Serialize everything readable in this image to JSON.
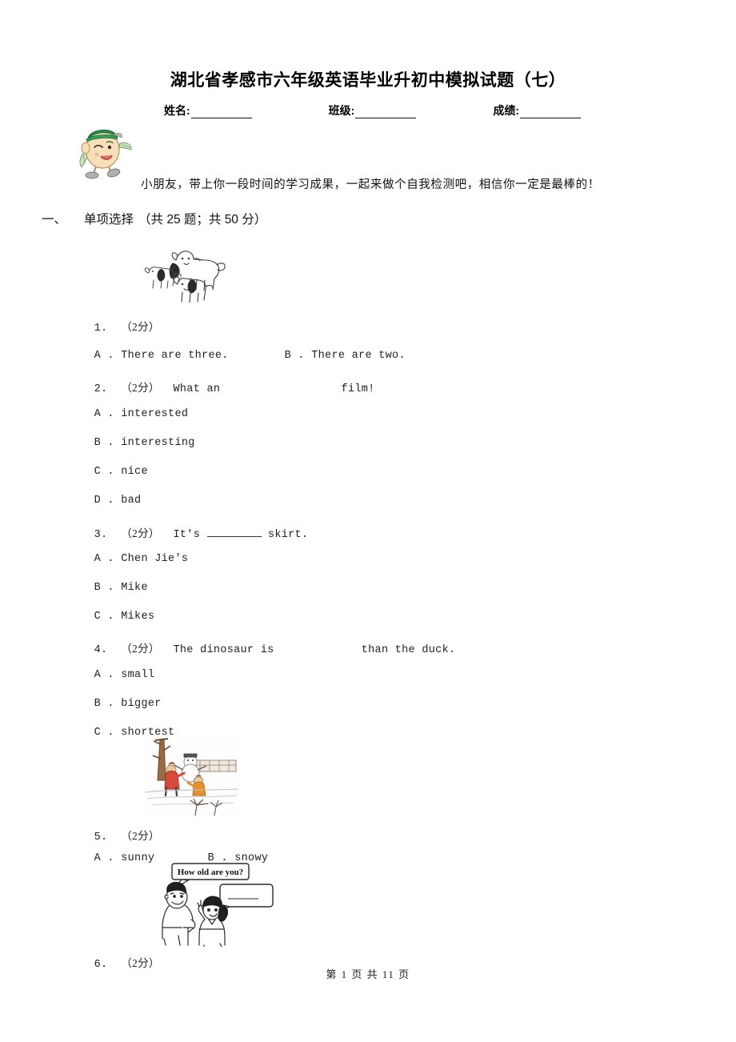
{
  "document": {
    "title": "湖北省孝感市六年级英语毕业升初中模拟试题（七）",
    "meta": {
      "name_label": "姓名:",
      "class_label": "班级:",
      "score_label": "成绩:"
    },
    "intro": "小朋友，带上你一段时间的学习成果，一起来做个自我检测吧，相信你一定是最棒的！",
    "footer": "第 1 页 共 11 页"
  },
  "section": {
    "index": "一、",
    "name": "单项选择",
    "meta": "（共 25 题；共 50 分）"
  },
  "questions": [
    {
      "number": "1.",
      "points": "（2分）",
      "stem": "",
      "figure": "three-dogs-illustration",
      "options": [
        {
          "letter": "A",
          "text": "There are three."
        },
        {
          "letter": "B",
          "text": "There are two."
        }
      ]
    },
    {
      "number": "2.",
      "points": "（2分）",
      "stem_before": "What an",
      "stem_after": "film!",
      "options": [
        {
          "letter": "A",
          "text": "interested"
        },
        {
          "letter": "B",
          "text": "interesting"
        },
        {
          "letter": "C",
          "text": "nice"
        },
        {
          "letter": "D",
          "text": "bad"
        }
      ]
    },
    {
      "number": "3.",
      "points": "（2分）",
      "stem_before": "It's",
      "stem_after": "skirt.",
      "options": [
        {
          "letter": "A",
          "text": "Chen Jie's"
        },
        {
          "letter": "B",
          "text": "Mike"
        },
        {
          "letter": "C",
          "text": "Mikes"
        }
      ]
    },
    {
      "number": "4.",
      "points": "（2分）",
      "stem_before": "The dinosaur is",
      "stem_after": "than the duck.",
      "options": [
        {
          "letter": "A",
          "text": "small"
        },
        {
          "letter": "B",
          "text": "bigger"
        },
        {
          "letter": "C",
          "text": "shortest"
        }
      ]
    },
    {
      "number": "5.",
      "points": "（2分）",
      "stem": "",
      "figure": "snowy-winter-scene-illustration",
      "options": [
        {
          "letter": "A",
          "text": "sunny"
        },
        {
          "letter": "B",
          "text": "snowy"
        }
      ]
    },
    {
      "number": "6.",
      "points": "（2分）",
      "stem": "",
      "figure": "how-old-are-you-dialogue-illustration",
      "options": []
    }
  ],
  "figures": {
    "dogs": {
      "name": "three-dogs-illustration"
    },
    "snow": {
      "name": "snowy-winter-scene-illustration"
    },
    "dialogue": {
      "name": "how-old-are-you-dialogue-illustration",
      "speech_bubble_text": "How old are you?",
      "reply_bubble_text": ""
    },
    "mascot": {
      "name": "cartoon-mascot-illustration"
    }
  },
  "colors": {
    "text": "#1a1a1a",
    "page_bg": "#ffffff",
    "mascot_cap": "#2e8b4f",
    "mascot_skin": "#f5dcb4"
  }
}
